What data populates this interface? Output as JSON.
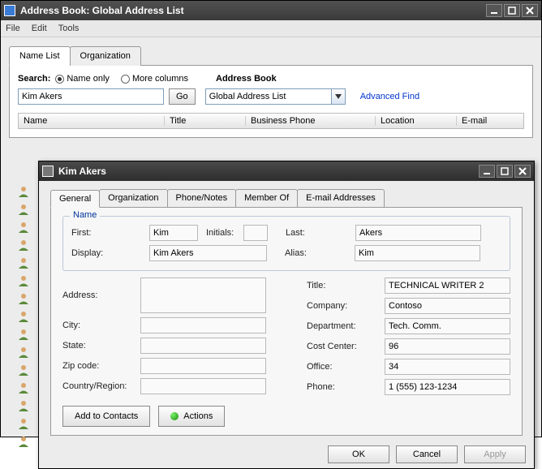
{
  "mainWindow": {
    "title": "Address Book: Global Address List",
    "menu": {
      "file": "File",
      "edit": "Edit",
      "tools": "Tools"
    },
    "outerTabs": {
      "nameList": "Name List",
      "organization": "Organization"
    },
    "searchLabel": "Search:",
    "radioNameOnly": "Name only",
    "radioMoreCols": "More columns",
    "addressBookLabel": "Address Book",
    "searchValue": "Kim Akers",
    "goLabel": "Go",
    "addressBookValue": "Global Address List",
    "advFind": "Advanced Find",
    "columns": {
      "name": "Name",
      "title": "Title",
      "bphone": "Business Phone",
      "location": "Location",
      "email": "E-mail"
    }
  },
  "dialog": {
    "title": "Kim Akers",
    "tabs": {
      "general": "General",
      "organization": "Organization",
      "phone": "Phone/Notes",
      "member": "Member Of",
      "email": "E-mail Addresses"
    },
    "legendName": "Name",
    "labels": {
      "first": "First:",
      "initials": "Initials:",
      "last": "Last:",
      "display": "Display:",
      "alias": "Alias:",
      "address": "Address:",
      "city": "City:",
      "state": "State:",
      "zip": "Zip code:",
      "country": "Country/Region:",
      "titleF": "Title:",
      "company": "Company:",
      "dept": "Department:",
      "cost": "Cost Center:",
      "office": "Office:",
      "phoneF": "Phone:"
    },
    "values": {
      "first": "Kim",
      "initials": "",
      "last": "Akers",
      "display": "Kim Akers",
      "alias": "Kim",
      "address": "",
      "city": "",
      "state": "",
      "zip": "",
      "country": "",
      "titleF": "TECHNICAL WRITER 2",
      "company": "Contoso",
      "dept": "Tech. Comm.",
      "cost": "96",
      "office": "34",
      "phoneF": "1 (555) 123-1234"
    },
    "addContacts": "Add to Contacts",
    "actions": "Actions",
    "ok": "OK",
    "cancel": "Cancel",
    "apply": "Apply"
  }
}
